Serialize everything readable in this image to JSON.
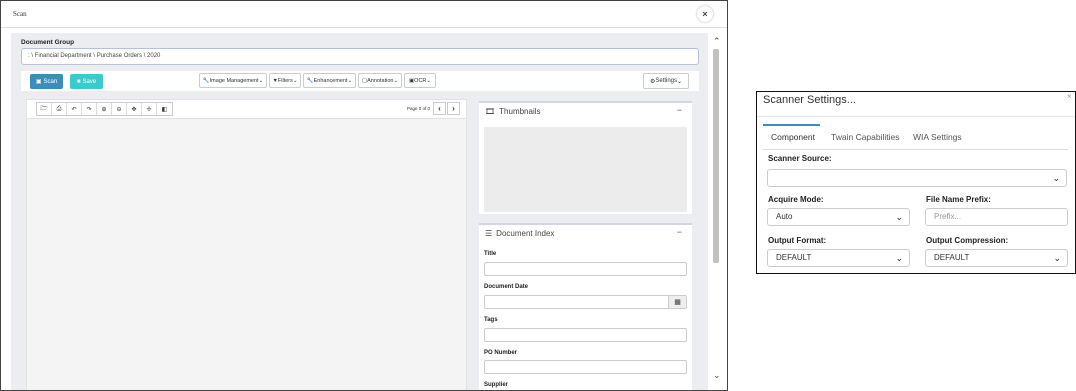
{
  "scan_window": {
    "title": "Scan",
    "close_symbol": "×",
    "document_group": {
      "label": "Document Group",
      "value": ": \\ Financial Department \\ Purchase Orders \\ 2020"
    },
    "toolbar": {
      "scan_label": "Scan",
      "save_label": "Save",
      "menus": [
        "Image Management",
        "Filters",
        "Enhancement",
        "Annotation",
        "OCR"
      ],
      "settings_label": "Settings"
    },
    "viewer": {
      "page_indicator": "Page 0 of 0",
      "tools": [
        "open-folder-icon",
        "print-icon",
        "undo-icon",
        "redo-icon",
        "zoom-in-icon",
        "zoom-out-icon",
        "fit-icon",
        "pan-icon",
        "binoculars-icon"
      ]
    },
    "thumbnails": {
      "title": "Thumbnails",
      "collapse": "−"
    },
    "document_index": {
      "title": "Document Index",
      "collapse": "−",
      "fields": [
        "Title",
        "Document Date",
        "Tags",
        "PO Number",
        "Supplier"
      ]
    }
  },
  "settings_dialog": {
    "title": "Scanner Settings...",
    "close_symbol": "×",
    "tabs": [
      "Component",
      "Twain Capabilities",
      "WIA Settings"
    ],
    "active_tab": "Component",
    "scanner_source": {
      "label": "Scanner Source:",
      "value": ""
    },
    "acquire_mode": {
      "label": "Acquire Mode:",
      "value": "Auto"
    },
    "file_name_prefix": {
      "label": "File Name Prefix:",
      "placeholder": "Prefix..."
    },
    "output_format": {
      "label": "Output Format:",
      "value": "DEFAULT"
    },
    "output_compression": {
      "label": "Output Compression:",
      "value": "DEFAULT"
    }
  },
  "colors": {
    "primary": "#3c8dbc",
    "save": "#39cccc",
    "body_bg": "#ecedf1"
  }
}
